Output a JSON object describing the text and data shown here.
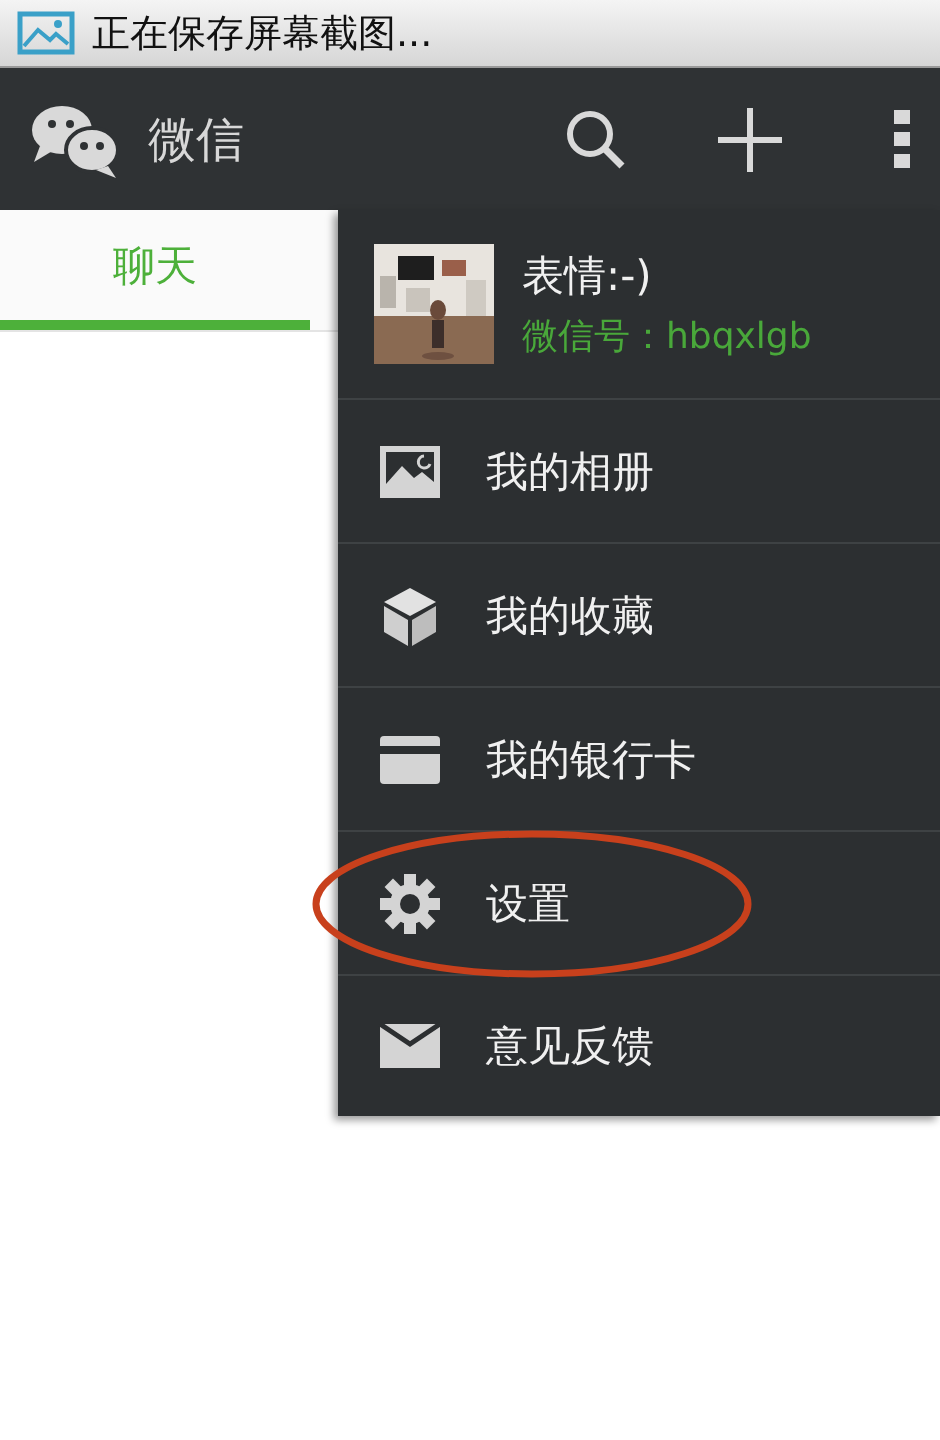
{
  "status_bar": {
    "text": "正在保存屏幕截图..."
  },
  "app_bar": {
    "title": "微信"
  },
  "tabs": [
    {
      "label": "聊天",
      "selected": true
    }
  ],
  "menu": {
    "profile": {
      "name": "表情:-)",
      "wechat_id": "微信号：hbqxlgb"
    },
    "items": [
      {
        "kind": "album",
        "label": "我的相册",
        "circled": false
      },
      {
        "kind": "favorites",
        "label": "我的收藏",
        "circled": false
      },
      {
        "kind": "card",
        "label": "我的银行卡",
        "circled": false
      },
      {
        "kind": "settings",
        "label": "设置",
        "circled": true
      },
      {
        "kind": "feedback",
        "label": "意见反馈",
        "circled": false
      }
    ]
  }
}
